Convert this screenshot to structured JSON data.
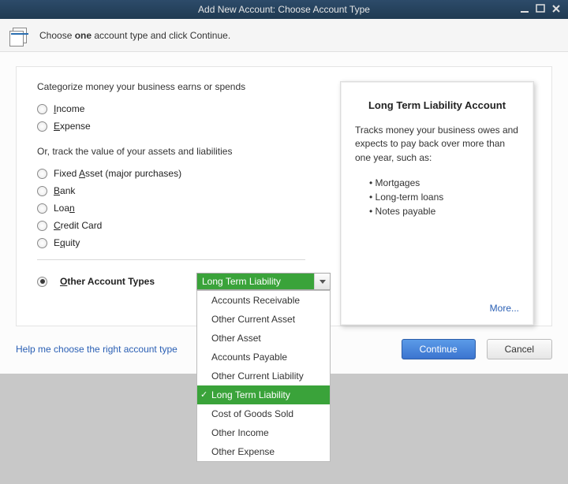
{
  "titlebar": {
    "title": "Add New Account: Choose Account Type"
  },
  "header": {
    "text_pre": "Choose ",
    "text_bold": "one",
    "text_post": " account type and click Continue."
  },
  "section1_text": "Categorize money your business earns or spends",
  "radios1": {
    "income": {
      "pre": "",
      "ul": "I",
      "post": "ncome"
    },
    "expense": {
      "pre": "",
      "ul": "E",
      "post": "xpense"
    }
  },
  "or_text": "Or, track the value of your assets and liabilities",
  "radios2": {
    "fixed_asset": {
      "pre": "Fixed ",
      "ul": "A",
      "post": "sset (major purchases)"
    },
    "bank": {
      "pre": "",
      "ul": "B",
      "post": "ank"
    },
    "loan": {
      "pre": "Loa",
      "ul": "n",
      "post": ""
    },
    "credit_card": {
      "pre": "",
      "ul": "C",
      "post": "redit Card"
    },
    "equity": {
      "pre": "E",
      "ul": "q",
      "post": "uity"
    }
  },
  "other_row": {
    "label_pre": "",
    "label_ul": "O",
    "label_post": "ther Account Types",
    "selected": "Long Term Liability"
  },
  "dropdown_items": [
    "Accounts Receivable",
    "Other Current Asset",
    "Other Asset",
    "Accounts Payable",
    "Other Current Liability",
    "Long Term Liability",
    "Cost of Goods Sold",
    "Other Income",
    "Other Expense"
  ],
  "info_box": {
    "title": "Long Term Liability Account",
    "desc": "Tracks money your business owes and expects to pay back over more than one year, such as:",
    "bullets": [
      "Mortgages",
      "Long-term loans",
      "Notes payable"
    ],
    "more": "More..."
  },
  "help_link": "Help me choose the right account type",
  "buttons": {
    "continue": "Continue",
    "cancel": "Cancel"
  }
}
